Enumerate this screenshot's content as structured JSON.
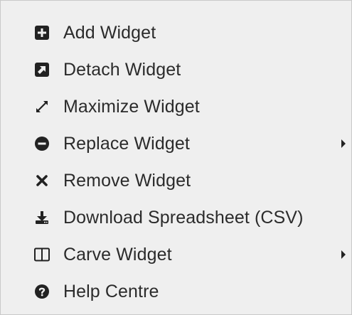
{
  "menu": {
    "items": [
      {
        "label": "Add Widget",
        "icon": "plus-square-icon"
      },
      {
        "label": "Detach Widget",
        "icon": "external-link-square-icon"
      },
      {
        "label": "Maximize Widget",
        "icon": "expand-arrows-icon"
      },
      {
        "label": "Replace Widget",
        "icon": "minus-circle-icon",
        "has_submenu": true
      },
      {
        "label": "Remove Widget",
        "icon": "times-icon"
      },
      {
        "label": "Download Spreadsheet (CSV)",
        "icon": "download-icon"
      },
      {
        "label": "Carve Widget",
        "icon": "columns-icon",
        "has_submenu": true
      },
      {
        "label": "Help Centre",
        "icon": "question-circle-icon"
      }
    ]
  },
  "colors": {
    "background": "#efefef",
    "text": "#2b2b2b",
    "icon": "#222222",
    "border": "#c9c9c9"
  }
}
